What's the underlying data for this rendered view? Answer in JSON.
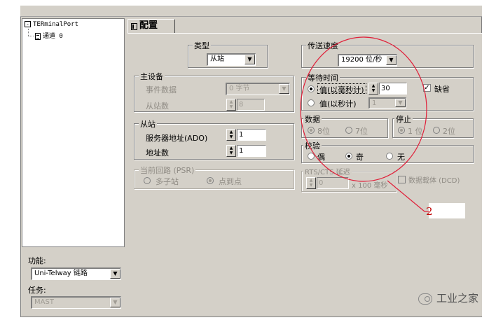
{
  "tree": {
    "root_label": "TERminalPort",
    "root_toggle": "-",
    "channel_label": "通道 0"
  },
  "left_panel": {
    "function_label": "功能:",
    "function_value": "Uni-Telway 链路",
    "task_label": "任务:",
    "task_value": "MAST"
  },
  "tab": {
    "label": "配置"
  },
  "type_group": {
    "label": "类型",
    "value": "从站"
  },
  "master": {
    "title": "主设备",
    "event_data_label": "事件数据",
    "event_data_value": "0 字节",
    "slave_count_label": "从站数",
    "slave_count_value": "8"
  },
  "slave": {
    "title": "从站",
    "server_address_label": "服务器地址(ADO)",
    "server_address_value": "1",
    "address_count_label": "地址数",
    "address_count_value": "1"
  },
  "current_loop": {
    "title": "当前回路 (PSR)",
    "multi_drop_label": "多子站",
    "point_to_point_label": "点到点"
  },
  "baud": {
    "title": "传送速度",
    "value": "19200 位/秒"
  },
  "wait_time": {
    "title": "等待时间",
    "ms_label": "值(以毫秒计)",
    "ms_value": "30",
    "default_label": "缺省",
    "s_label": "值(以秒计)",
    "s_value": "1"
  },
  "data_bits": {
    "title": "数据",
    "opt8": "8位",
    "opt7": "7位"
  },
  "stop_bits": {
    "title": "停止",
    "opt1": "1 位",
    "opt2": "2位"
  },
  "parity": {
    "title": "校验",
    "even": "偶",
    "odd": "奇",
    "none": "无"
  },
  "rts_cts": {
    "title": "RTS/CTS 延迟",
    "value": "0",
    "unit": "x 100 毫秒",
    "dcd_label": "数据载体 (DCD)"
  },
  "annotation": {
    "number": "2"
  },
  "watermark": {
    "text": "工业之家"
  },
  "colors": {
    "annotation_red": "#e0203a",
    "window_gray": "#d4d0c8"
  }
}
